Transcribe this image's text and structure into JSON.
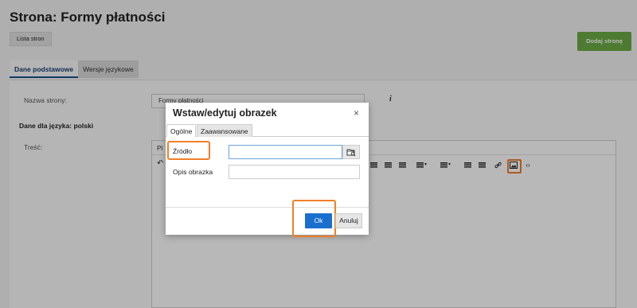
{
  "page": {
    "title": "Strona: Formy płatności",
    "list_button": "Lista stron",
    "add_button": "Dodaj stronę",
    "tabs": [
      {
        "label": "Dane podstawowe",
        "active": true
      },
      {
        "label": "Wersje językowe",
        "active": false
      }
    ]
  },
  "form": {
    "name_label": "Nazwa strony:",
    "name_value": "Formy płatności",
    "info_icon": "i",
    "language_section": "Dane dla języka: polski",
    "content_label": "Treść:"
  },
  "editor": {
    "menubar_visible_text": "Pl",
    "toolbar_icons": [
      "undo-icon",
      "align-left-icon",
      "align-center-icon",
      "align-right-icon",
      "align-justify-icon",
      "bullet-list-icon",
      "numbered-list-icon",
      "outdent-icon",
      "indent-icon",
      "link-icon",
      "image-icon",
      "source-code-icon"
    ]
  },
  "dialog": {
    "title": "Wstaw/edytuj obrazek",
    "close": "×",
    "tabs": [
      {
        "label": "Ogólne",
        "active": true
      },
      {
        "label": "Zaawansowane",
        "active": false
      }
    ],
    "source_label": "Źródło",
    "source_value": "",
    "alt_label": "Opis obrazka",
    "alt_value": "",
    "ok_label": "Ok",
    "cancel_label": "Anuluj"
  },
  "colors": {
    "accent_green": "#6bab44",
    "primary_blue": "#1a6fce",
    "highlight_orange": "#f07f2a"
  }
}
